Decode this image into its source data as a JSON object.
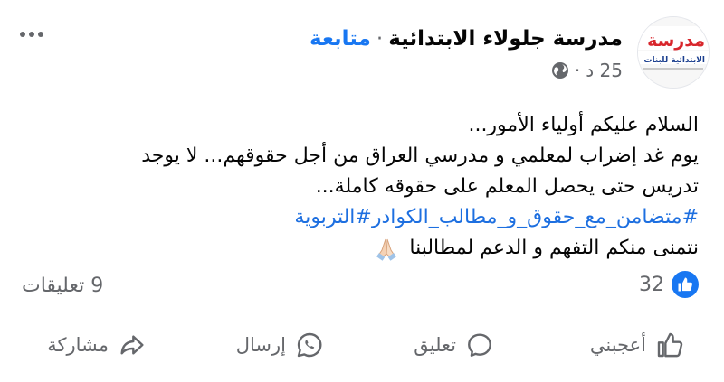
{
  "header": {
    "page_name": "مدرسة جلولاء الابتدائية",
    "separator": "·",
    "follow_label": "متابعة",
    "time": "25 د",
    "privacy_icon": "globe-icon",
    "more_icon": "more-icon"
  },
  "avatar": {
    "line1": "مدرسة جلو",
    "line2": "الابتدائية للبنات"
  },
  "post": {
    "line1": "السلام عليكم أولياء الأمور...",
    "line2": "يوم غد إضراب لمعلمي و مدرسي العراق من أجل حقوقهم... لا يوجد",
    "line3": "تدريس حتى يحصل المعلم على حقوقه كاملة...",
    "hashtag1": "#متضامن_مع_حقوق_و_مطالب_الكوادر",
    "hashtag2": "#التربوية",
    "line5": "نتمنى منكم التفهم و الدعم لمطالبنا"
  },
  "stats": {
    "likes_count": "32",
    "comments": "9 تعليقات"
  },
  "actions": {
    "like": "أعجبني",
    "comment": "تعليق",
    "send": "إرسال",
    "share": "مشاركة"
  },
  "colors": {
    "accent": "#1877f2",
    "muted": "#65676b",
    "hashtag": "#1d6fe0"
  }
}
